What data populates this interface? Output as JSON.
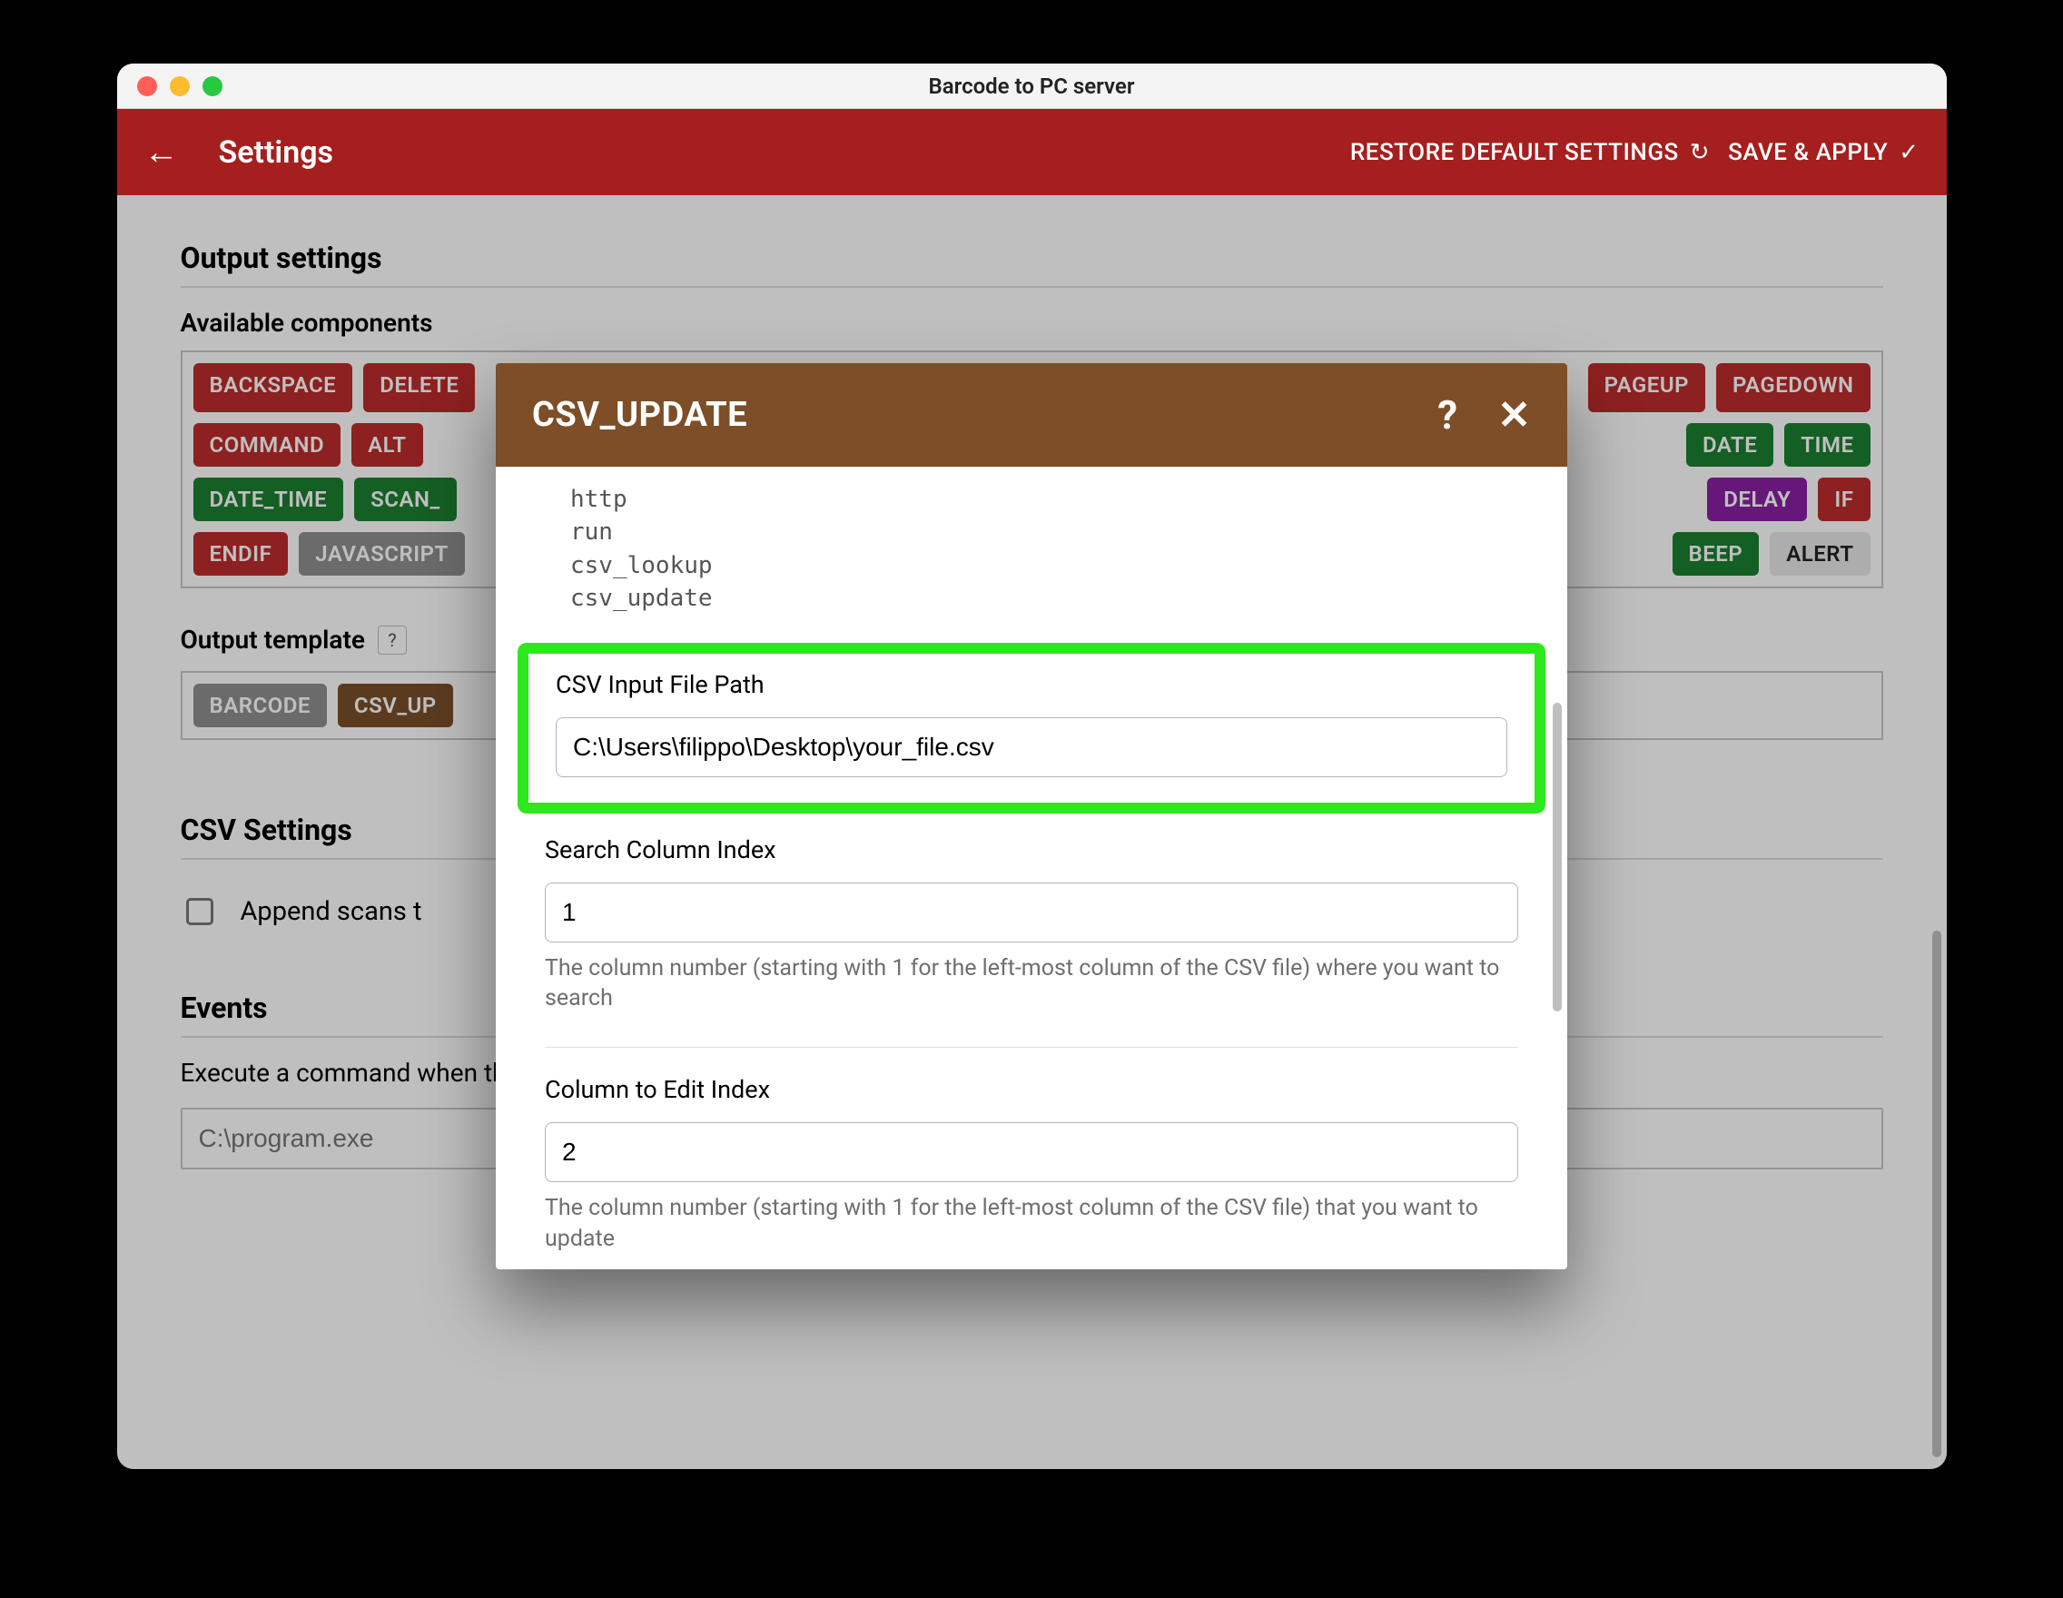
{
  "window": {
    "title": "Barcode to PC server"
  },
  "header": {
    "title": "Settings",
    "restore": "RESTORE DEFAULT SETTINGS",
    "apply": "SAVE & APPLY"
  },
  "output_settings": {
    "title": "Output settings",
    "available_label": "Available components",
    "components": [
      {
        "label": "BACKSPACE",
        "color": "c-red"
      },
      {
        "label": "DELETE",
        "color": "c-red"
      },
      {
        "label": "PAGEUP",
        "color": "c-red"
      },
      {
        "label": "PAGEDOWN",
        "color": "c-red"
      },
      {
        "label": "COMMAND",
        "color": "c-red"
      },
      {
        "label": "ALT",
        "color": "c-red"
      },
      {
        "label": "DATE",
        "color": "c-green"
      },
      {
        "label": "TIME",
        "color": "c-green"
      },
      {
        "label": "DATE_TIME",
        "color": "c-green"
      },
      {
        "label": "SCAN_",
        "color": "c-green"
      },
      {
        "label": "DELAY",
        "color": "c-purple"
      },
      {
        "label": "IF",
        "color": "c-red"
      },
      {
        "label": "ENDIF",
        "color": "c-red"
      },
      {
        "label": "JAVASCRIPT",
        "color": "c-gray"
      },
      {
        "label": "BEEP",
        "color": "c-green"
      },
      {
        "label": "ALERT",
        "color": "c-light"
      }
    ],
    "template_label": "Output template",
    "template_items": [
      {
        "label": "BARCODE",
        "color": "c-gray"
      },
      {
        "label": "CSV_UP",
        "color": "c-brown"
      }
    ]
  },
  "csv_settings": {
    "title": "CSV Settings",
    "append_label": "Append scans t"
  },
  "events": {
    "title": "Events",
    "desc": "Execute a command when the smartphone power cord is plugged in",
    "placeholder": "C:\\program.exe"
  },
  "modal": {
    "title": "CSV_UPDATE",
    "code_lines": [
      "http",
      "run",
      "csv_lookup",
      "csv_update"
    ],
    "csv_path": {
      "label": "CSV Input File Path",
      "value": "C:\\Users\\filippo\\Desktop\\your_file.csv"
    },
    "search_col": {
      "label": "Search Column Index",
      "value": "1",
      "help": "The column number (starting with 1 for the left-most column of the CSV file) where you want to search"
    },
    "edit_col": {
      "label": "Column to Edit Index",
      "value": "2",
      "help": "The column number (starting with 1 for the left-most column of the CSV file) that you want to update"
    }
  }
}
